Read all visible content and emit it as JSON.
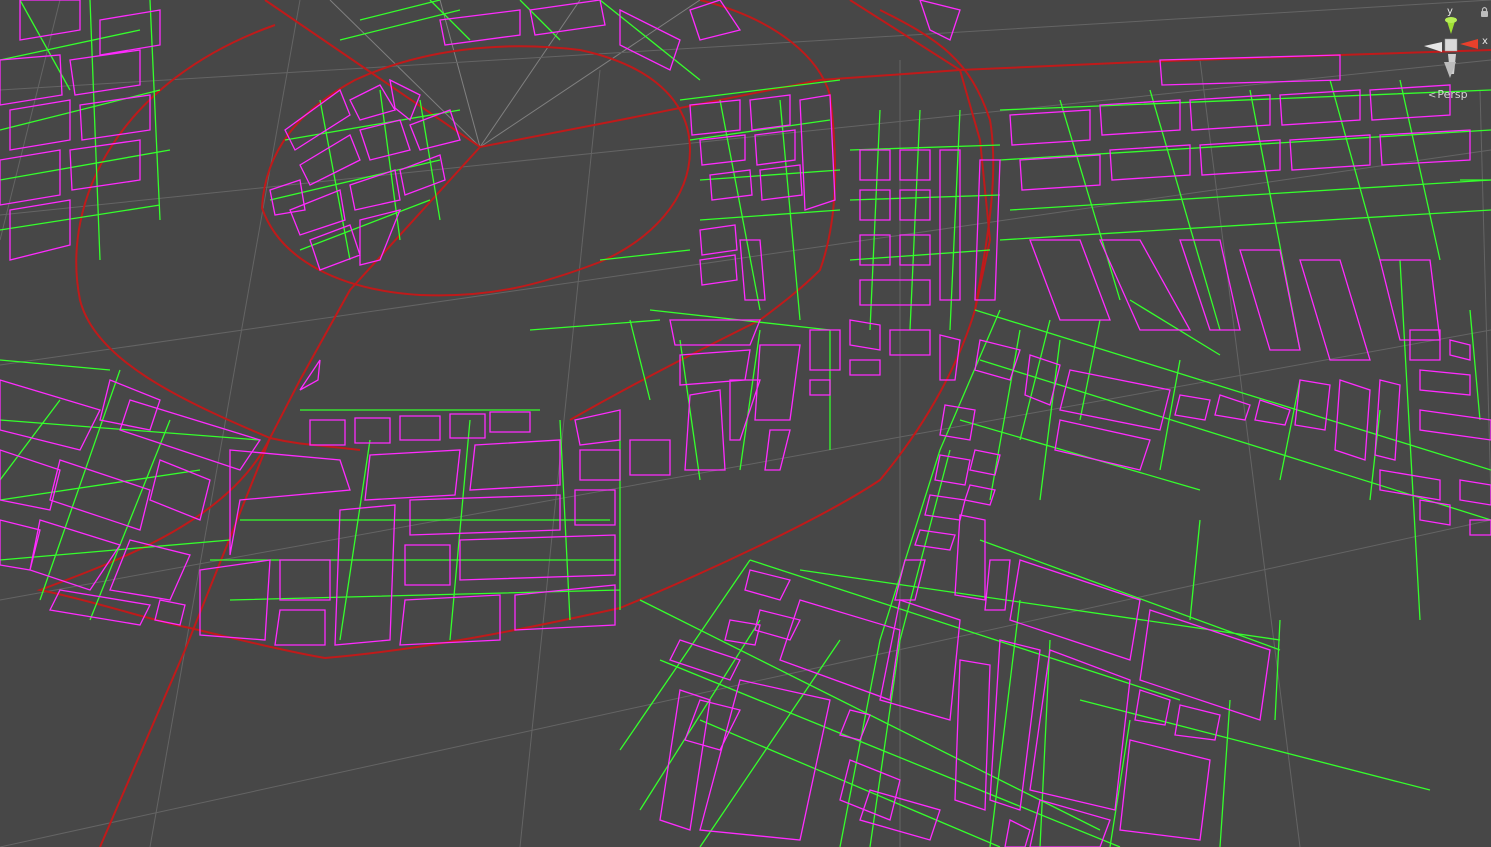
{
  "scene_view": {
    "projection_label": "Persp",
    "axes": {
      "x": "x",
      "y": "y"
    },
    "colors": {
      "background": "#474747",
      "grid": "#6a6a6a",
      "road_outline": "#ff2bff",
      "road_centerline": "#35ff2c",
      "boundary": "#c01a1a",
      "gizmo_x": "#e8402b",
      "gizmo_y": "#9fe033",
      "gizmo_neutral": "#cfcfcf"
    },
    "icons": {
      "lock": "lock-icon",
      "orientation_gizmo": "scene-gizmo-icon",
      "projection_chevron": "chevron-left-icon"
    }
  }
}
